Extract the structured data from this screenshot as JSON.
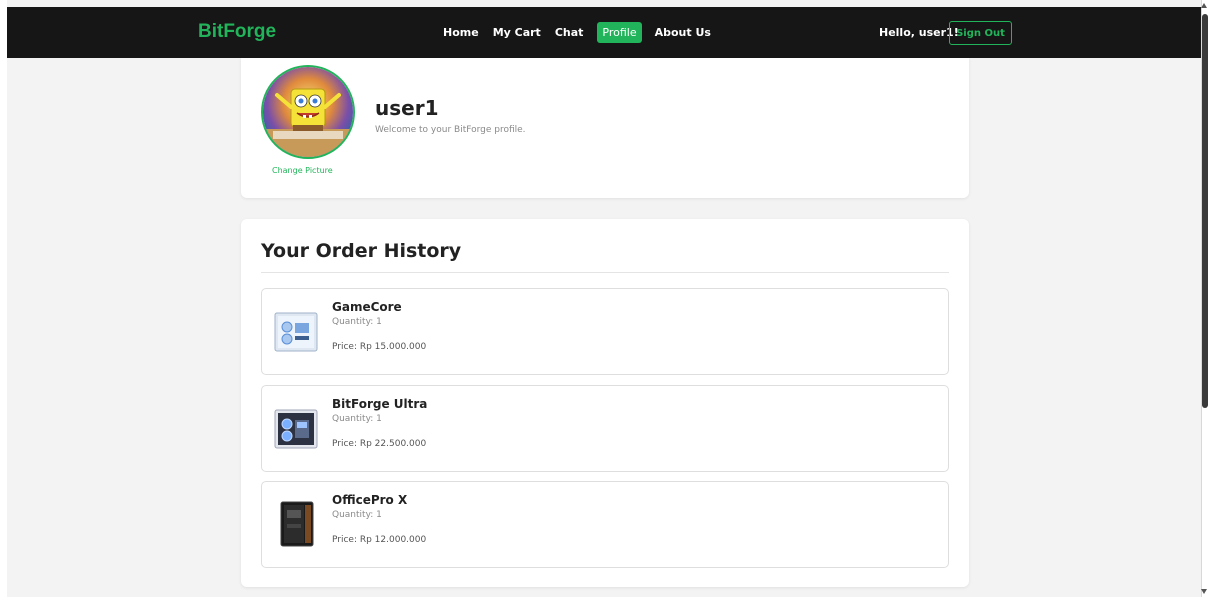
{
  "navbar": {
    "brand": "BitForge",
    "links": [
      {
        "label": "Home"
      },
      {
        "label": "My Cart"
      },
      {
        "label": "Chat"
      },
      {
        "label": "Profile",
        "active": true
      },
      {
        "label": "About Us"
      }
    ],
    "greeting": "Hello, user1!",
    "signout_label": "Sign Out"
  },
  "profile": {
    "username": "user1",
    "welcome": "Welcome to your BitForge profile.",
    "change_picture": "Change Picture"
  },
  "orders": {
    "title": "Your Order History",
    "items": [
      {
        "name": "GameCore",
        "quantity": "Quantity: 1",
        "price": "Price: Rp 15.000.000"
      },
      {
        "name": "BitForge Ultra",
        "quantity": "Quantity: 1",
        "price": "Price: Rp 22.500.000"
      },
      {
        "name": "OfficePro X",
        "quantity": "Quantity: 1",
        "price": "Price: Rp 12.000.000"
      }
    ]
  },
  "colors": {
    "accent": "#22b45a",
    "navbar_bg": "#161616",
    "page_bg": "#f3f3f3"
  }
}
